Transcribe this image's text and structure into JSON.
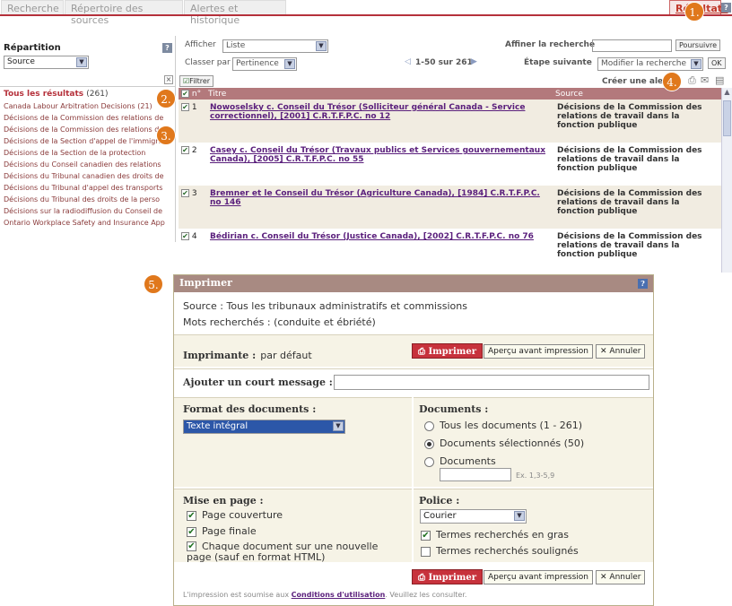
{
  "tabs": [
    "Recherche",
    "Répertoire des sources",
    "Alertes et historique",
    "Résultats"
  ],
  "markers": [
    "1.",
    "2.",
    "3.",
    "4.",
    "5."
  ],
  "left": {
    "title": "Répartition",
    "select": "Source",
    "all_results": "Tous les résultats",
    "all_count": "(261)",
    "items": [
      "Canada Labour Arbitration Decisions (21)",
      "Décisions de la Commission des relations de",
      "Décisions de la Commission des relations de",
      "Décisions de la Section d'appel de l'immigra",
      "Décisions de la Section de la protection",
      "Décisions du Conseil canadien des relations",
      "Décisions du Tribunal canadien des droits de",
      "Décisions du Tribunal d'appel des transports",
      "Décisions du Tribunal des droits de la perso",
      "Décisions sur la radiodiffusion du Conseil de",
      "Ontario Workplace Safety and Insurance App"
    ]
  },
  "toolbar": {
    "afficher_label": "Afficher",
    "afficher_value": "Liste",
    "affiner_label": "Affiner la recherche",
    "poursuivre": "Poursuivre",
    "classer_label": "Classer par",
    "classer_value": "Pertinence",
    "range": "1-50 sur 261",
    "etape_label": "Étape suivante",
    "etape_value": "Modifier la recherche",
    "ok": "OK",
    "filtrer": "Filtrer",
    "alert": "Créer une aler"
  },
  "table": {
    "headers": [
      "n°",
      "Titre",
      "Source"
    ],
    "rows": [
      {
        "n": "1",
        "title": "Nowoselsky c. Conseil du Trésor (Solliciteur général Canada - Service correctionnel), [2001] C.R.T.F.P.C. no 12",
        "source": "Décisions de la Commission des relations de travail dans la fonction publique"
      },
      {
        "n": "2",
        "title": "Casey c. Conseil du Trésor (Travaux publics et Services gouvernementaux Canada), [2005] C.R.T.F.P.C. no 55",
        "source": "Décisions de la Commission des relations de travail dans la fonction publique"
      },
      {
        "n": "3",
        "title": "Bremner et le Conseil du Trésor (Agriculture Canada), [1984] C.R.T.F.P.C. no 146",
        "source": "Décisions de la Commission des relations de travail dans la fonction publique"
      },
      {
        "n": "4",
        "title": "Bédirian c. Conseil du Trésor (Justice Canada), [2002] C.R.T.F.P.C. no 76",
        "source": "Décisions de la Commission des relations de travail dans la fonction publique"
      }
    ]
  },
  "dialog": {
    "title": "Imprimer",
    "source_label": "Source :",
    "source_value": "Tous les tribunaux administratifs et commissions",
    "mots_label": "Mots recherchés :",
    "mots_value": "(conduite et ébriété)",
    "imprimante_label": "Imprimante :",
    "imprimante_value": "par défaut",
    "imprimer": "Imprimer",
    "apercu": "Aperçu avant impression",
    "annuler": "Annuler",
    "message_label": "Ajouter un court message :",
    "format_label": "Format des documents :",
    "format_value": "Texte intégral",
    "documents_label": "Documents :",
    "doc_opts": [
      "Tous les documents (1 - 261)",
      "Documents sélectionnés (50)",
      "Documents"
    ],
    "doc_hint": "Ex. 1,3-5,9",
    "mise_label": "Mise en page :",
    "mise_opts": [
      "Page couverture",
      "Page finale",
      "Chaque document sur une nouvelle page (sauf en format HTML)"
    ],
    "police_label": "Police :",
    "police_value": "Courier",
    "police_opts": [
      "Termes recherchés en gras",
      "Termes recherchés soulignés"
    ],
    "footer_pre": "L'impression est soumise aux",
    "footer_link": "Conditions d'utilisation",
    "footer_post": ". Veuillez les consulter."
  }
}
